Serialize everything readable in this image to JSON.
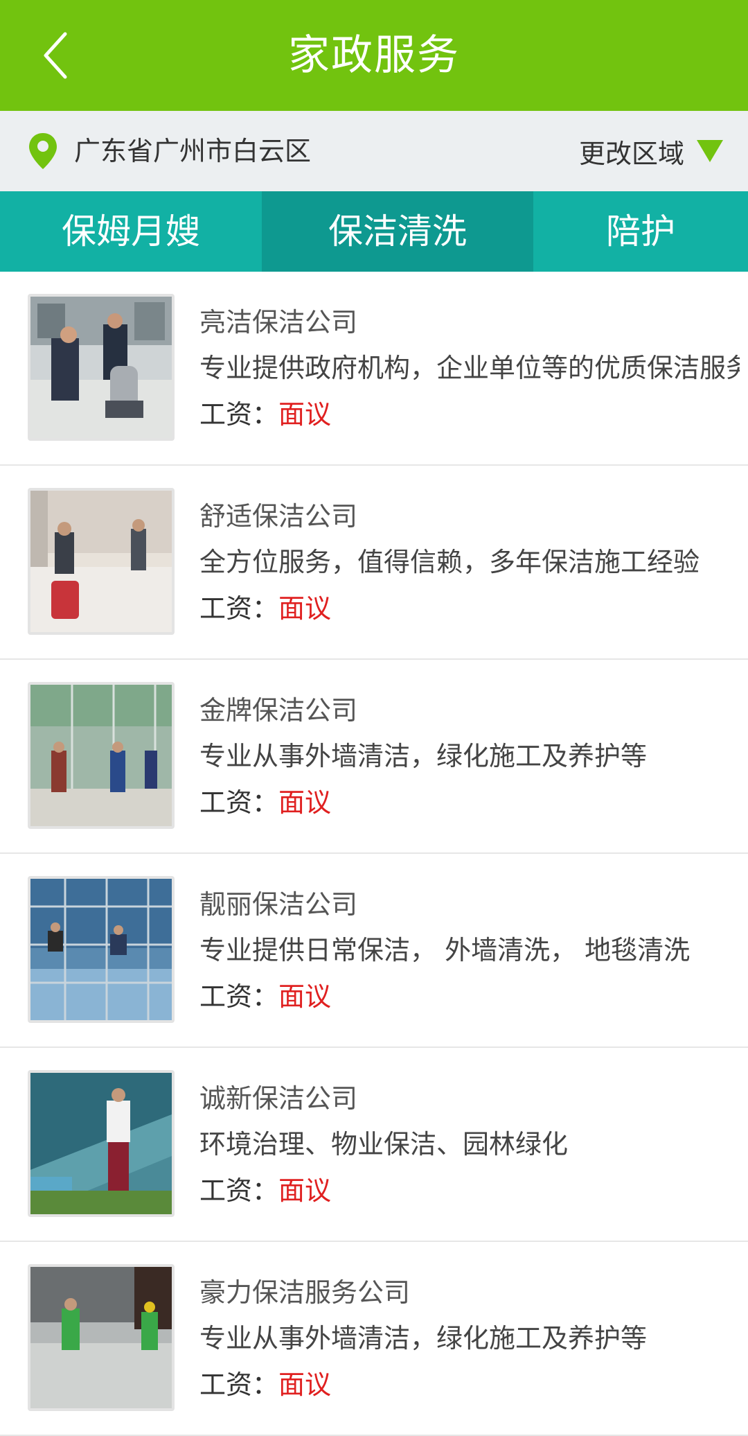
{
  "header": {
    "title": "家政服务",
    "back_icon": "back-chevron-icon"
  },
  "location": {
    "address": "广东省广州市白云区",
    "change_label": "更改区域",
    "pin_color": "#72c30f",
    "triangle_color": "#72c30f"
  },
  "tabs": [
    {
      "label": "保姆月嫂",
      "active": false
    },
    {
      "label": "保洁清洗",
      "active": true
    },
    {
      "label": "陪护",
      "active": false
    }
  ],
  "salary_label": "工资：",
  "companies": [
    {
      "name": "亮洁保洁公司",
      "desc": "专业提供政府机构，企业单位等的优质保洁服务",
      "salary": "面议"
    },
    {
      "name": "舒适保洁公司",
      "desc": "全方位服务，值得信赖，多年保洁施工经验",
      "salary": "面议"
    },
    {
      "name": "金牌保洁公司",
      "desc": "专业从事外墙清洁，绿化施工及养护等",
      "salary": "面议"
    },
    {
      "name": "靓丽保洁公司",
      "desc": "专业提供日常保洁， 外墙清洗， 地毯清洗",
      "salary": "面议"
    },
    {
      "name": "诚新保洁公司",
      "desc": "环境治理、物业保洁、园林绿化",
      "salary": "面议"
    },
    {
      "name": "豪力保洁服务公司",
      "desc": "专业从事外墙清洁，绿化施工及养护等",
      "salary": "面议"
    }
  ]
}
